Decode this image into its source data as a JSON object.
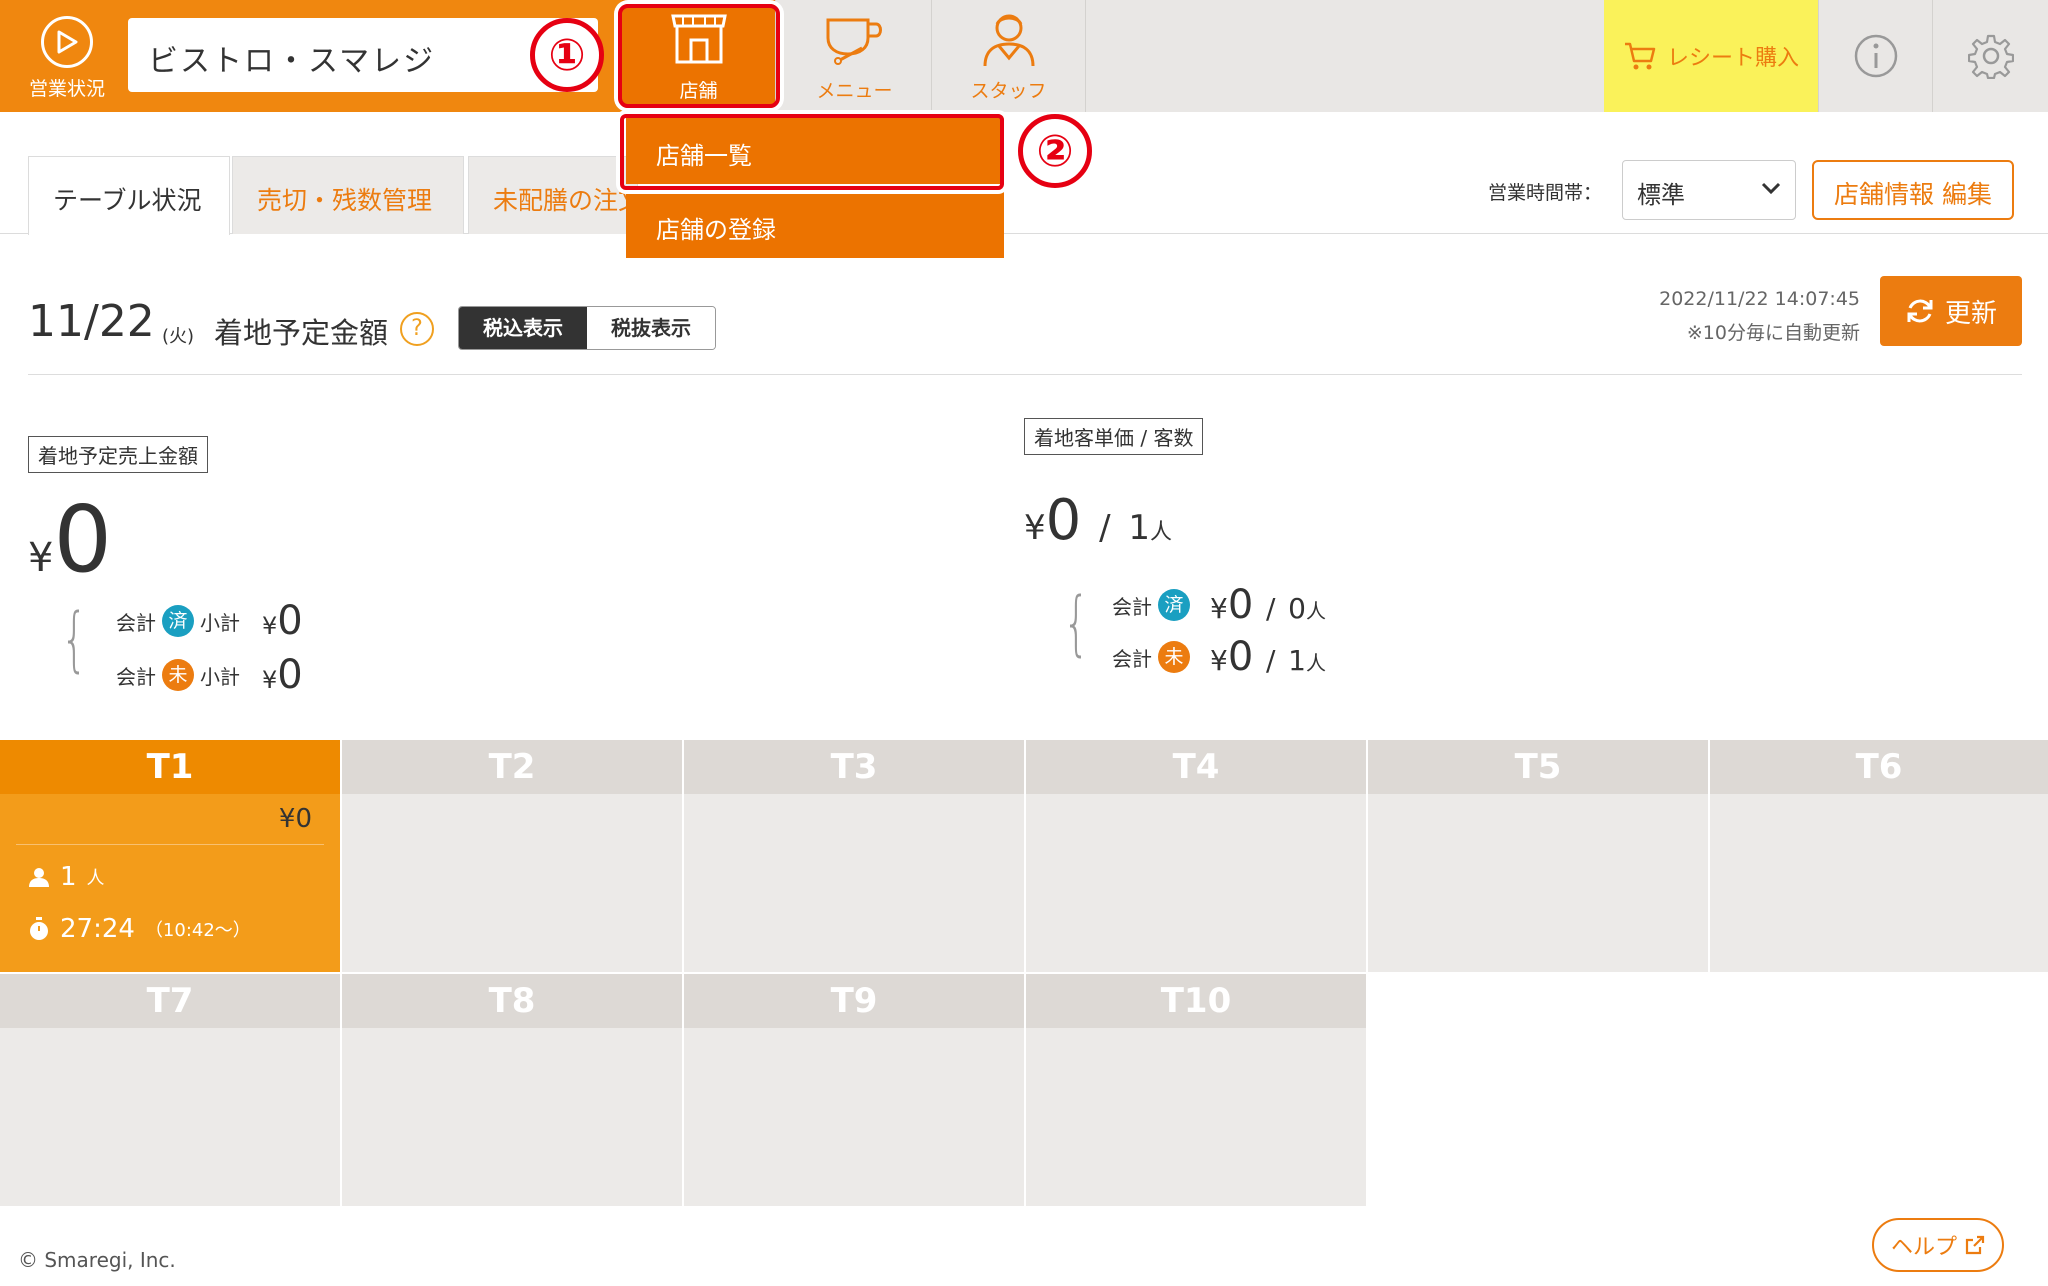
{
  "header": {
    "status_label": "営業状況",
    "store_name": "ビストロ・スマレジ",
    "nav": {
      "store": "店舗",
      "menu": "メニュー",
      "staff": "スタッフ"
    },
    "receipt_label": "レシート購入",
    "annotation_1": "①",
    "annotation_2": "②"
  },
  "store_dropdown": {
    "items": [
      "店舗一覧",
      "店舗の登録"
    ]
  },
  "tabs": [
    "テーブル状況",
    "売切・残数管理",
    "未配膳の注文"
  ],
  "timeslot": {
    "label": "営業時間帯：",
    "value": "標準"
  },
  "edit_store_label": "店舗情報 編集",
  "summary": {
    "date": "11/22",
    "day": "(火)",
    "title": "着地予定金額",
    "help": "?",
    "tax_included": "税込表示",
    "tax_excluded": "税抜表示",
    "timestamp": "2022/11/22 14:07:45",
    "auto_update_note": "※10分毎に自動更新",
    "refresh_label": "更新"
  },
  "sales": {
    "label": "着地予定売上金額",
    "yen": "¥",
    "total": "0",
    "done_row": {
      "prefix": "会計",
      "badge": "済",
      "suffix": "小計",
      "yen": "¥",
      "value": "0"
    },
    "undone_row": {
      "prefix": "会計",
      "badge": "未",
      "suffix": "小計",
      "yen": "¥",
      "value": "0"
    }
  },
  "average": {
    "label": "着地客単価 / 客数",
    "yen": "¥",
    "price": "0",
    "sep": "/",
    "count": "1",
    "unit": "人",
    "done_row": {
      "prefix": "会計",
      "badge": "済",
      "yen": "¥",
      "price": "0",
      "sep": "/",
      "count": "0",
      "unit": "人"
    },
    "undone_row": {
      "prefix": "会計",
      "badge": "未",
      "yen": "¥",
      "price": "0",
      "sep": "/",
      "count": "1",
      "unit": "人"
    }
  },
  "tables": [
    {
      "name": "T1",
      "active": true,
      "amount": "¥0",
      "guests": "1",
      "guests_unit": "人",
      "elapsed": "27:24",
      "since": "（10:42〜）"
    },
    {
      "name": "T2"
    },
    {
      "name": "T3"
    },
    {
      "name": "T4"
    },
    {
      "name": "T5"
    },
    {
      "name": "T6"
    },
    {
      "name": "T7"
    },
    {
      "name": "T8"
    },
    {
      "name": "T9"
    },
    {
      "name": "T10"
    }
  ],
  "footer": {
    "copyright": "© Smaregi, Inc.",
    "help_label": "ヘルプ"
  },
  "colors": {
    "brand_orange": "#ec7c10",
    "annotation_red": "#e60012",
    "done_badge": "#1a9fc1",
    "receipt_bg": "#faf25a"
  },
  "icons": [
    "play-circle-icon",
    "storefront-icon",
    "coffee-cup-icon",
    "staff-person-icon",
    "cart-icon",
    "info-icon",
    "gear-icon",
    "refresh-icon",
    "chevron-down-icon",
    "person-icon",
    "stopwatch-icon",
    "external-link-icon"
  ]
}
